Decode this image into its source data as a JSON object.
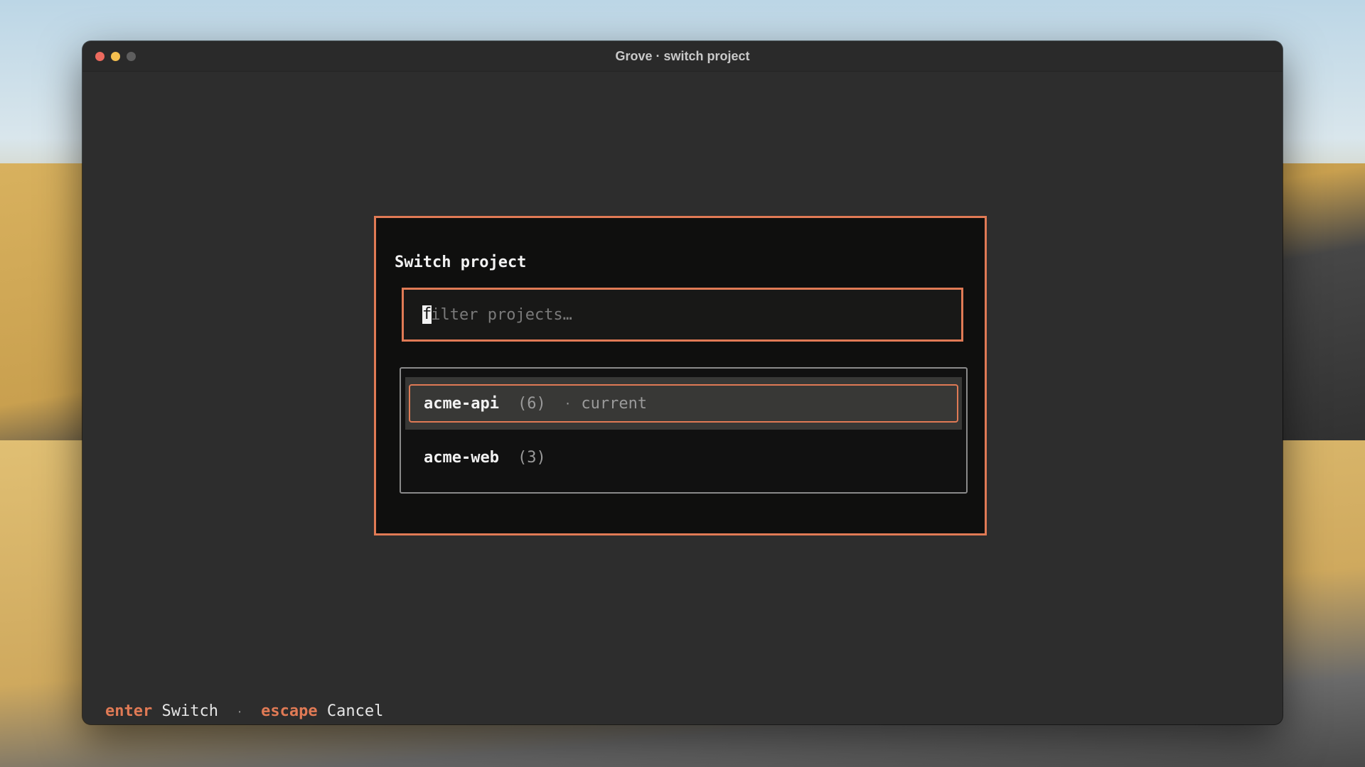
{
  "window": {
    "title": "Grove · switch project"
  },
  "modal": {
    "title": "Switch project",
    "filter": {
      "placeholder": "filter projects…",
      "value": "",
      "cursor_char": "f"
    },
    "projects": [
      {
        "name": "acme-api",
        "count": "(6)",
        "separator": "·",
        "tag": "current",
        "selected": true
      },
      {
        "name": "acme-web",
        "count": "(3)",
        "separator": "",
        "tag": "",
        "selected": false
      }
    ]
  },
  "statusbar": {
    "enter_key": "enter",
    "enter_label": "Switch",
    "separator": "·",
    "escape_key": "escape",
    "escape_label": "Cancel"
  },
  "colors": {
    "accent": "#e07a55",
    "background": "#2d2d2d",
    "modal_bg": "#0f0f0e"
  },
  "icons": [
    "close-light-icon",
    "minimize-light-icon",
    "maximize-light-icon"
  ]
}
